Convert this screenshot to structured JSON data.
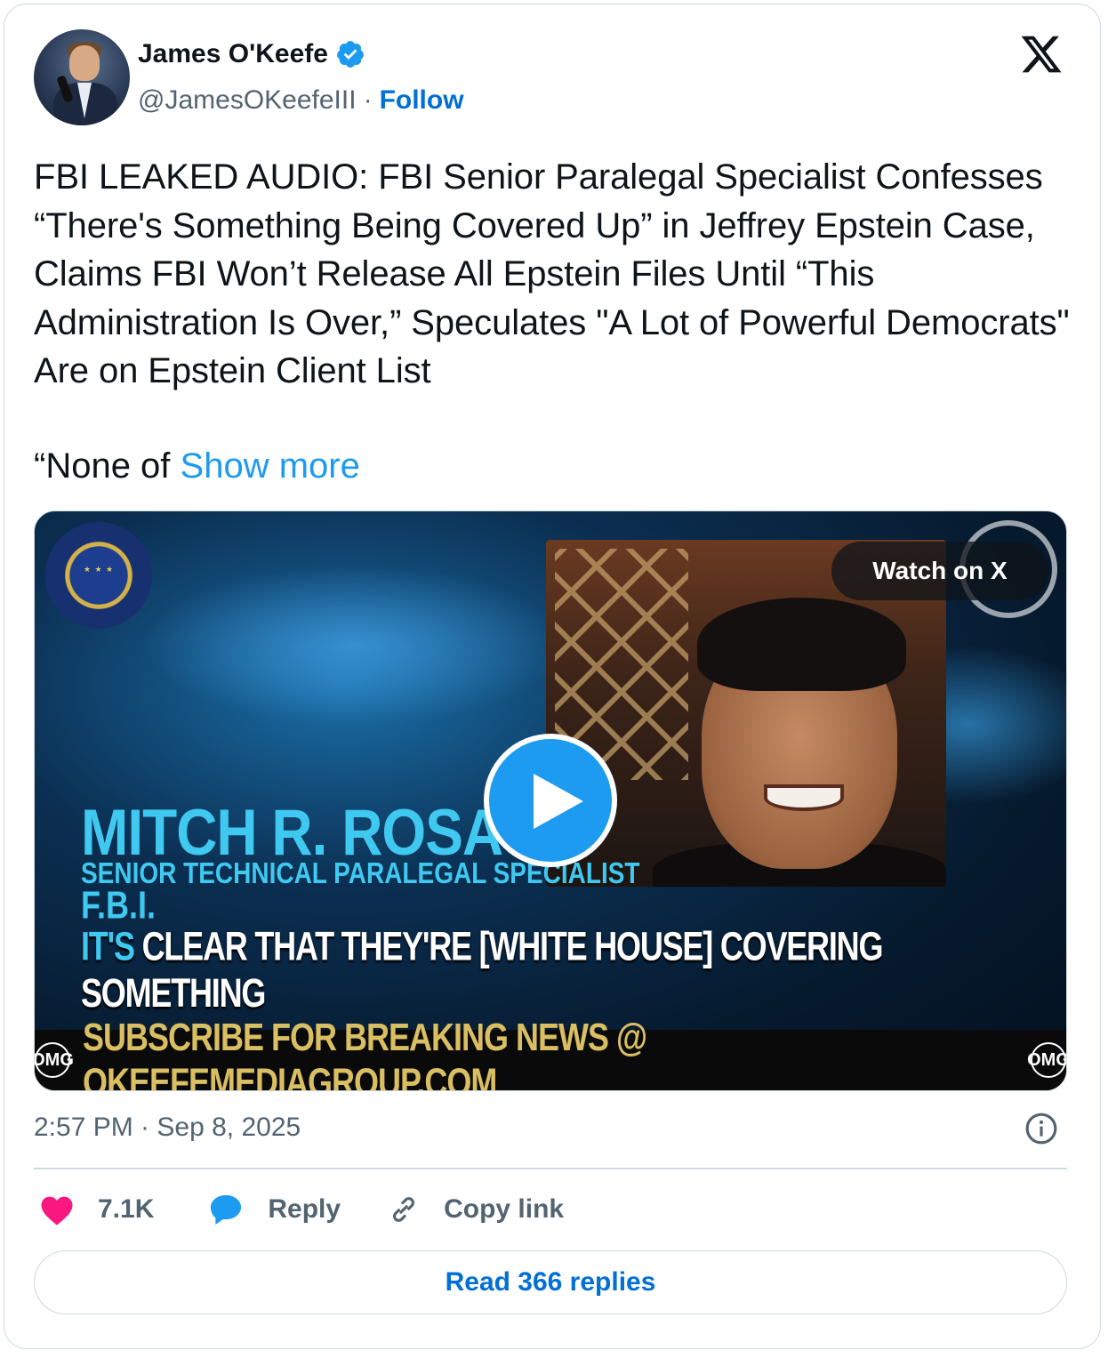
{
  "author": {
    "name": "James O'Keefe",
    "handle": "@JamesOKeefeIII",
    "separator": "·",
    "follow_label": "Follow"
  },
  "tweet": {
    "text": "FBI LEAKED AUDIO: FBI Senior Paralegal Specialist Confesses “There's Something Being Covered Up” in Jeffrey Epstein Case, Claims FBI Won’t Release All Epstein Files Until “This Administration Is Over,” Speculates \"A Lot of Powerful Democrats\" Are on Epstein Client List",
    "continuation": "“None of ",
    "show_more_label": "Show more"
  },
  "media": {
    "watch_label": "Watch on X",
    "subject_name": "MITCH R. ROSAS",
    "subject_title": "SENIOR TECHNICAL PARALEGAL SPECIALIST",
    "subject_org": "F.B.I.",
    "quote_prefix": "IT'S",
    "quote_rest": " CLEAR THAT THEY'RE [WHITE HOUSE] COVERING SOMETHING",
    "ticker": "SUBSCRIBE FOR BREAKING NEWS @ OKEEFEMEDIAGROUP.COM",
    "omg_badge": "OMG"
  },
  "meta": {
    "timestamp": "2:57 PM · Sep 8, 2025"
  },
  "actions": {
    "like_count": "7.1K",
    "reply_label": "Reply",
    "copy_label": "Copy link"
  },
  "footer": {
    "read_replies_label": "Read 366 replies"
  },
  "colors": {
    "accent": "#1d9bf0",
    "link": "#006fd6",
    "like": "#f91880",
    "muted": "#536471",
    "border": "#cfd9de"
  },
  "icons": [
    "verified-badge-icon",
    "x-logo-icon",
    "play-icon",
    "info-icon",
    "heart-icon",
    "reply-bubble-icon",
    "link-icon"
  ]
}
